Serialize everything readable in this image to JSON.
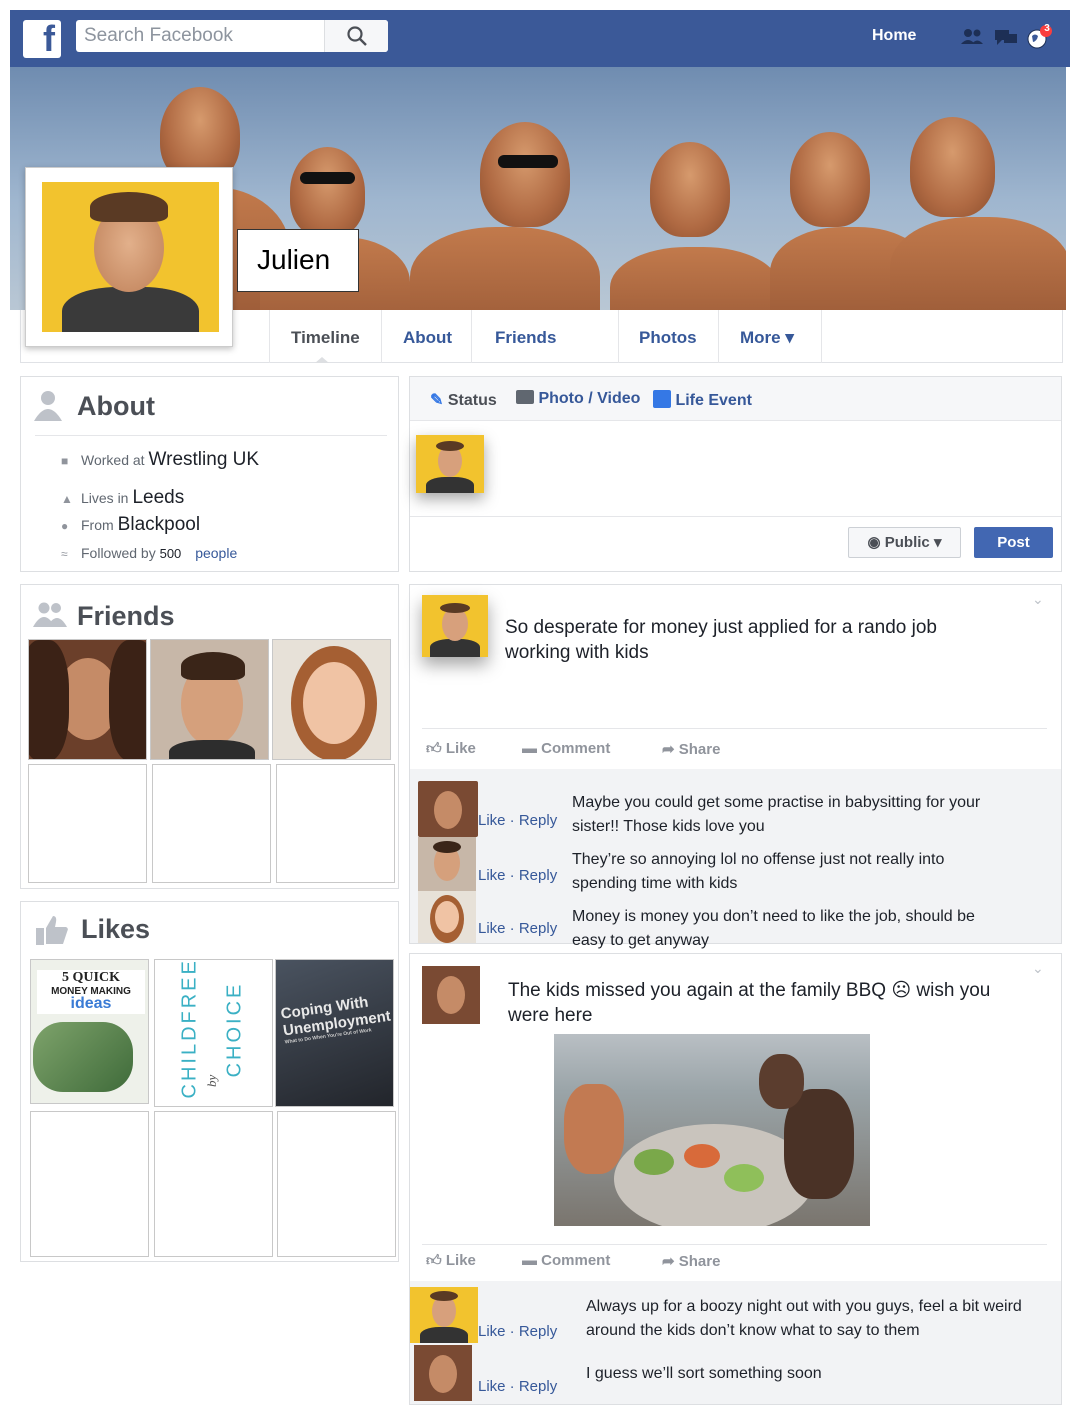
{
  "topbar": {
    "search_placeholder": "Search Facebook",
    "home_label": "Home",
    "notification_count": "3",
    "logo_letter": "f"
  },
  "profile": {
    "name": "Julien"
  },
  "tabs": [
    "Timeline",
    "About",
    "Friends",
    "Photos",
    "More ▾"
  ],
  "about": {
    "title": "About",
    "worked_at_label": "Worked at",
    "worked_at_value": "Wrestling UK",
    "lives_in_label": "Lives in",
    "lives_in_value": "Leeds",
    "from_label": "From",
    "from_value": "Blackpool",
    "followed_by_label": "Followed by",
    "followed_by_count": "500",
    "followed_by_suffix": "people"
  },
  "friends": {
    "title": "Friends"
  },
  "likes": {
    "title": "Likes",
    "pages": [
      {
        "line1": "5 QUICK",
        "line2": "MONEY MAKING",
        "line3": "ideas"
      },
      {
        "line1": "CHILDFREE",
        "line2": "by",
        "line3": "CHOICE"
      },
      {
        "line1": "Coping With",
        "line2": "Unemployment",
        "line3": "What to Do When You're Out of Work"
      }
    ]
  },
  "composer": {
    "status_label": "Status",
    "photo_label": "Photo / Video",
    "life_event_label": "Life Event",
    "audience_label": "Public ▾",
    "post_button": "Post"
  },
  "posts": [
    {
      "text": "So desperate for money just applied for a rando job working with kids",
      "actions": {
        "like": "Like",
        "comment": "Comment",
        "share": "Share"
      },
      "comments": [
        {
          "text": "Maybe you could get some practise in babysitting for your sister!! Those kids love you",
          "like_reply": "Like · Reply"
        },
        {
          "text": "They’re so annoying lol no offense just not really into spending time with kids",
          "like_reply": "Like · Reply"
        },
        {
          "text": "Money is money you don’t need to like the job, should be easy to get anyway",
          "like_reply": "Like · Reply"
        }
      ]
    },
    {
      "text": "The kids missed you again at the family BBQ ☹ wish you were here",
      "actions": {
        "like": "Like",
        "comment": "Comment",
        "share": "Share"
      },
      "comments": [
        {
          "text": "Always up for a boozy night out with you guys, feel a bit weird around the kids don’t know what to say to them",
          "like_reply": "Like · Reply"
        },
        {
          "text": "I guess we’ll sort something soon",
          "like_reply": "Like · Reply"
        }
      ]
    }
  ],
  "colors": {
    "brand": "#3b5998",
    "link": "#365899",
    "post_button": "#4267b2",
    "profile_bg": "#f2c32e"
  }
}
